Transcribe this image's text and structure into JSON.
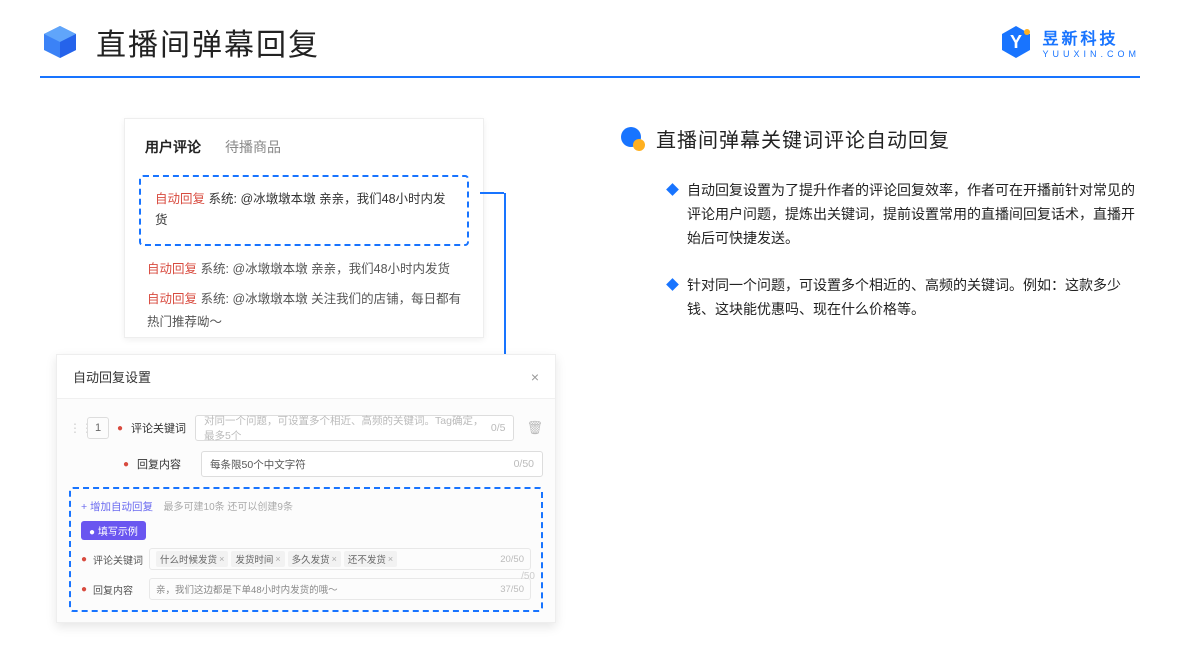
{
  "header": {
    "title": "直播间弹幕回复",
    "brand_name": "昱新科技",
    "brand_url": "YUUXIN.COM"
  },
  "comments": {
    "tab_active": "用户评论",
    "tab_inactive": "待播商品",
    "auto_tag": "自动回复",
    "sys_prefix": "系统:",
    "highlight_text": "@冰墩墩本墩 亲亲，我们48小时内发货",
    "line2": "@冰墩墩本墩 亲亲，我们48小时内发货",
    "line3": "@冰墩墩本墩 关注我们的店铺，每日都有热门推荐呦～"
  },
  "settings": {
    "title": "自动回复设置",
    "close": "×",
    "order": "1",
    "kw_label": "评论关键词",
    "kw_placeholder": "对同一个问题，可设置多个相近、高频的关键词。Tag确定，最多5个",
    "kw_count": "0/5",
    "reply_label": "回复内容",
    "reply_placeholder": "每条限50个中文字符",
    "reply_count": "0/50",
    "add_link": "+ 增加自动回复",
    "add_hint": "最多可建10条 还可以创建9条",
    "example_badge": "● 填写示例",
    "ex_kw_label": "评论关键词",
    "ex_tags": [
      "什么时候发货",
      "发货时间",
      "多久发货",
      "还不发货"
    ],
    "ex_kw_count": "20/50",
    "ex_reply_label": "回复内容",
    "ex_reply_text": "亲，我们这边都是下单48小时内发货的哦～",
    "ex_reply_count": "37/50",
    "ghost_count": "/50"
  },
  "right": {
    "section_title": "直播间弹幕关键词评论自动回复",
    "bullet1": "自动回复设置为了提升作者的评论回复效率，作者可在开播前针对常见的评论用户问题，提炼出关键词，提前设置常用的直播间回复话术，直播开始后可快捷发送。",
    "bullet2": "针对同一个问题，可设置多个相近的、高频的关键词。例如：这款多少钱、这块能优惠吗、现在什么价格等。"
  }
}
